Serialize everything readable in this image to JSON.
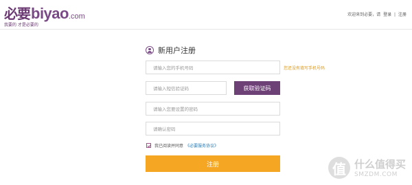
{
  "header": {
    "logo_cn": "必要",
    "logo_en": "biyao",
    "logo_tld": ".com",
    "slogan": "我要的 才是必要的",
    "welcome": "欢迎来到必要，请",
    "login": "登录",
    "separator": "|",
    "register": "注册"
  },
  "form": {
    "title": "新用户注册",
    "phone_placeholder": "请输入您的手机号码",
    "phone_hint": "您还没有填写手机号码",
    "code_placeholder": "请输入短信验证码",
    "get_code_button": "获取验证码",
    "password_placeholder": "请输入您要设置的密码",
    "confirm_placeholder": "请确认密码",
    "agree_text": "我已阅读并同意",
    "agreement_link": "《必要服务协议》",
    "agreed": true,
    "submit_label": "注册"
  },
  "watermark": {
    "glyph": "值",
    "cn": "什么值得买",
    "en": "SMZDM.COM"
  },
  "colors": {
    "brand_purple": "#6d4176",
    "submit_orange": "#f5a623",
    "hint_orange": "#d99a22",
    "link_blue": "#2a7db8"
  }
}
